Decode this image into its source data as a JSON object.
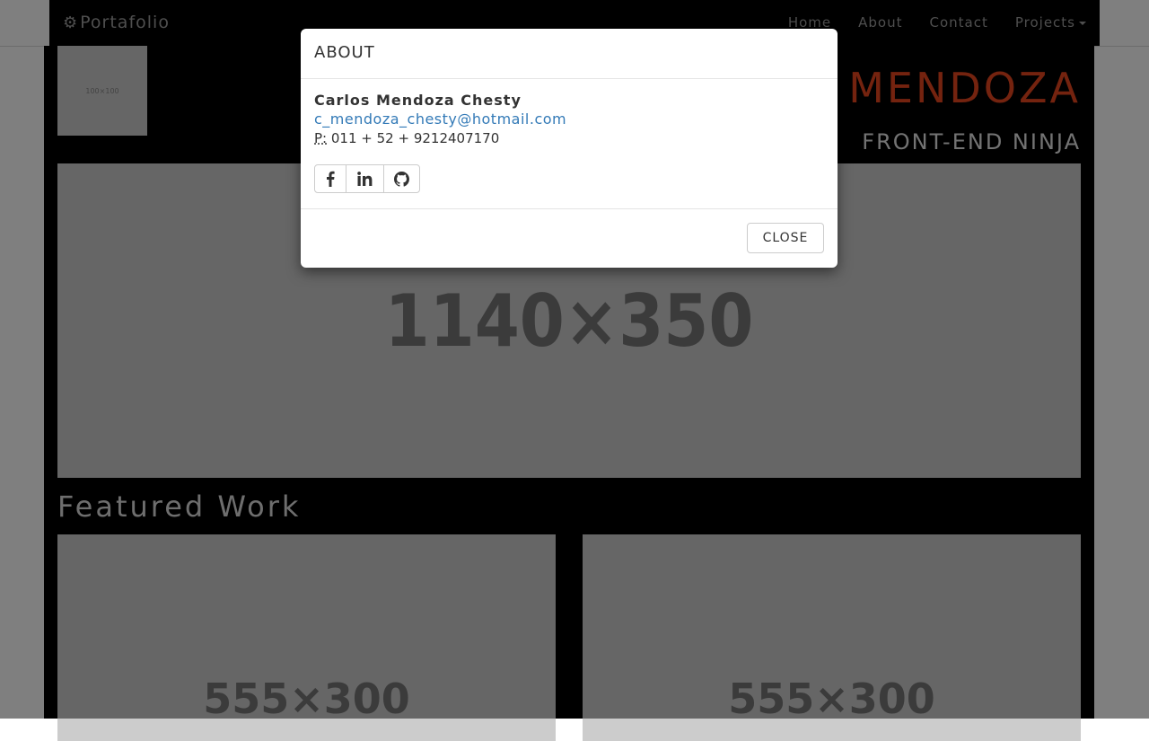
{
  "navbar": {
    "brand": "Portafolio",
    "links": [
      "Home",
      "About",
      "Contact",
      "Projects"
    ]
  },
  "hero": {
    "thumb_label": "100×100",
    "name": "MENDOZA",
    "subtitle": "FRONT-END NINJA",
    "banner_label": "1140×350"
  },
  "featured": {
    "title": "Featured Work",
    "cards": [
      "555×300",
      "555×300"
    ]
  },
  "modal": {
    "title": "ABOUT",
    "person_name": "Carlos Mendoza Chesty",
    "email": "c_mendoza_chesty@hotmail.com",
    "phone_label": "P:",
    "phone": "011 + 52 + 9212407170",
    "close_label": "CLOSE"
  },
  "colors": {
    "accent": "#e8461e",
    "link": "#337ab7",
    "backdrop": "rgba(0,0,0,0.5)"
  }
}
